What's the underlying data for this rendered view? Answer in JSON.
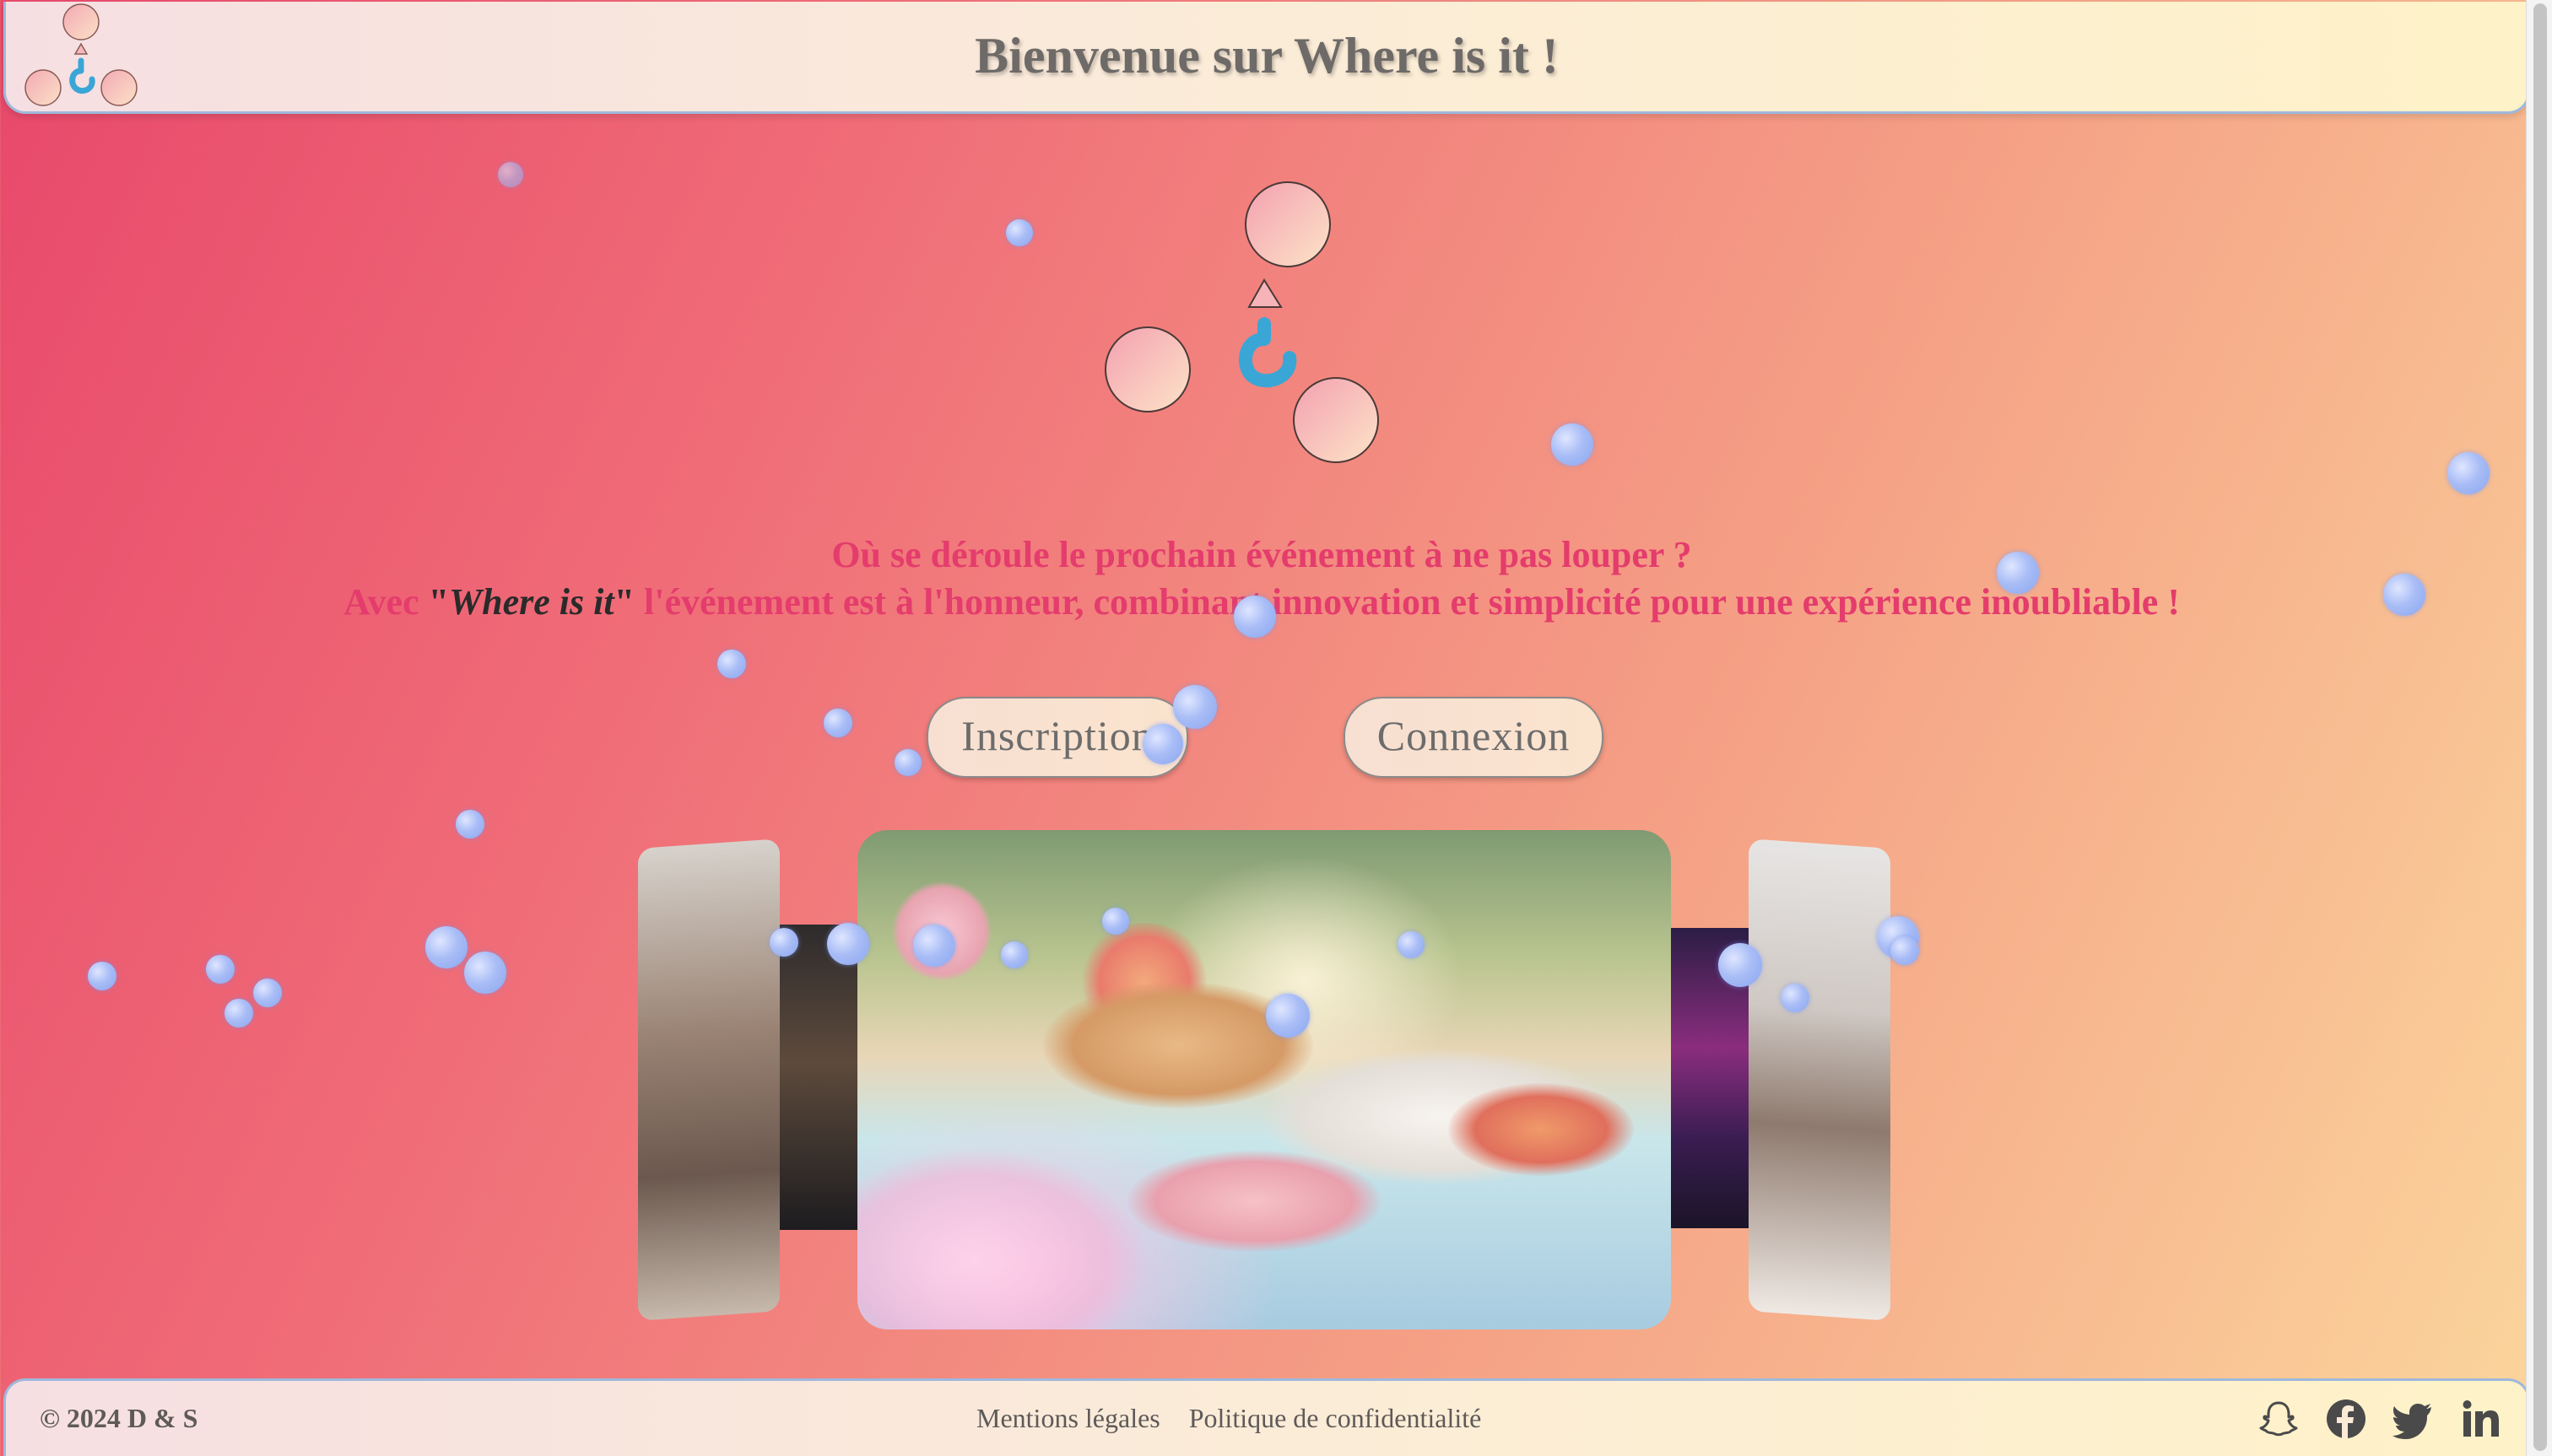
{
  "header": {
    "title": "Bienvenue sur Where is it !",
    "logo_icon": "where-is-it-logo"
  },
  "hero": {
    "tagline_line1": "Où se déroule le prochain événement à ne pas louper ?",
    "tagline_line2_prefix": "Avec ",
    "tagline_line2_quote_open": "\"",
    "tagline_line2_brand": "Where is it",
    "tagline_line2_quote_close": "\"",
    "tagline_line2_suffix": " l'événement est à l'honneur, combinant innovation et simplicité pour une expérience inoubliable !"
  },
  "buttons": {
    "signup": "Inscription",
    "login": "Connexion"
  },
  "carousel": {
    "slides": [
      "party-group-photo",
      "barbecue-photo",
      "buffet-table-photo",
      "concert-photo",
      "wedding-couple-photo"
    ],
    "active": "buffet-table-photo"
  },
  "footer": {
    "copyright": "© 2024 D & S",
    "links": [
      "Mentions légales",
      "Politique de confidentialité"
    ],
    "socials": [
      "snapchat-icon",
      "facebook-icon",
      "twitter-icon",
      "linkedin-icon"
    ]
  },
  "colors": {
    "accent_text": "#e43c6c",
    "header_border": "#9fb8dc",
    "logo_blue": "#3aa6d6"
  }
}
